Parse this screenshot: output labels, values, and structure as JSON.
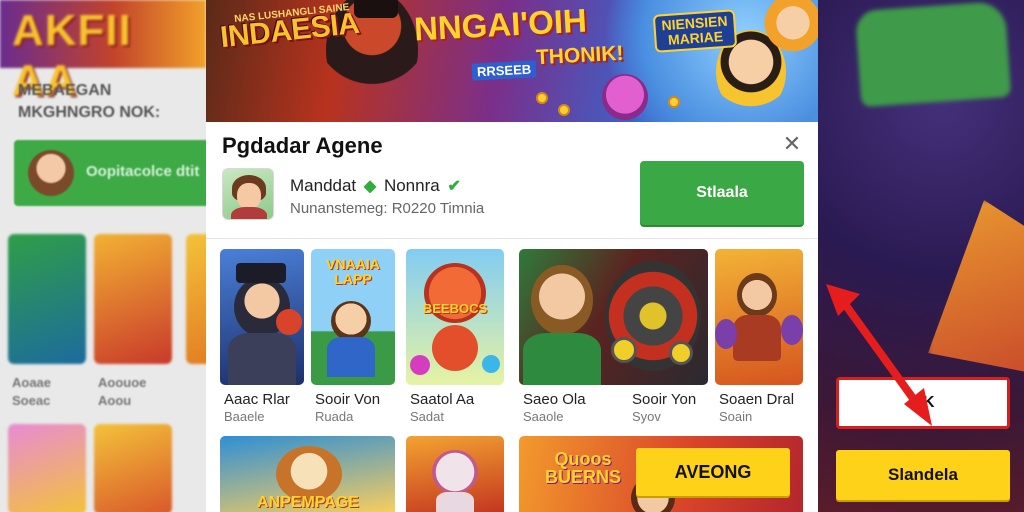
{
  "background": {
    "left_banner_text": "AKFII AA",
    "left_text_lines": [
      "MEBAEGAN",
      "MKGHNGRO NOK:"
    ],
    "left_button_label": "Oopitacolce dtit",
    "left_captions": [
      [
        "Aoaae",
        "Soeac"
      ],
      [
        "Aoouoe",
        "Aoou"
      ]
    ]
  },
  "hero": {
    "title_small": "NAS LUSHANGLI SAINE",
    "title_left": "INDAESIA",
    "title_main": "NNGAI'OIH",
    "title_sub": "THONIK!",
    "title_sub_badge": "RRSEEB",
    "title_right_line1": "NIENSIEN",
    "title_right_line2": "MARIAE"
  },
  "modal": {
    "title": "Pgdadar Agene",
    "close_icon": "close-icon",
    "account": {
      "name": "Manddat",
      "name_extra": "Nonnra",
      "sub": "Nunanstemeg: R0220 Timnia",
      "verified_icon": "check-icon"
    },
    "primary_button": "Stlaala",
    "action_button": "AVEONG",
    "games": [
      {
        "name": "Aaac Rlar",
        "meta": "Baaele",
        "art_label": "",
        "colors": [
          "#3b6fd1",
          "#223a7a"
        ]
      },
      {
        "name": "Sooir Von",
        "meta": "Ruada",
        "art_label": "VNAAIA LAPP",
        "colors": [
          "#9ad1f7",
          "#2d8e3a"
        ]
      },
      {
        "name": "Saatol Aa",
        "meta": "Sadat",
        "art_label": "BEEBOCS",
        "colors": [
          "#7ec8f0",
          "#f2e26b"
        ]
      },
      {
        "name": "Saeo Ola",
        "meta": "Saaole",
        "art_label": "",
        "colors": [
          "#3d8a3f",
          "#8a2a22"
        ]
      },
      {
        "name": "Sooir Yon",
        "meta": "Syov",
        "art_label": "",
        "colors": [
          "#f2a12a",
          "#d24b1f"
        ]
      },
      {
        "name": "Soaen Dral",
        "meta": "Soain",
        "art_label": "",
        "colors": [
          "#f0a62b",
          "#c2451d"
        ]
      },
      {
        "name": "",
        "meta": "",
        "art_label": "ANPEMPAGE",
        "colors": [
          "#2e8fd6",
          "#f2b233"
        ]
      },
      {
        "name": "",
        "meta": "",
        "art_label": "",
        "colors": [
          "#f3a331",
          "#c2321f"
        ]
      },
      {
        "name": "",
        "meta": "",
        "art_label": "Quoos BUERNS",
        "colors": [
          "#f07a2a",
          "#b3262c"
        ]
      }
    ]
  },
  "overlay": {
    "white_button": "CK",
    "yellow_button": "Slandela",
    "arrow_color": "#e51d1d"
  }
}
